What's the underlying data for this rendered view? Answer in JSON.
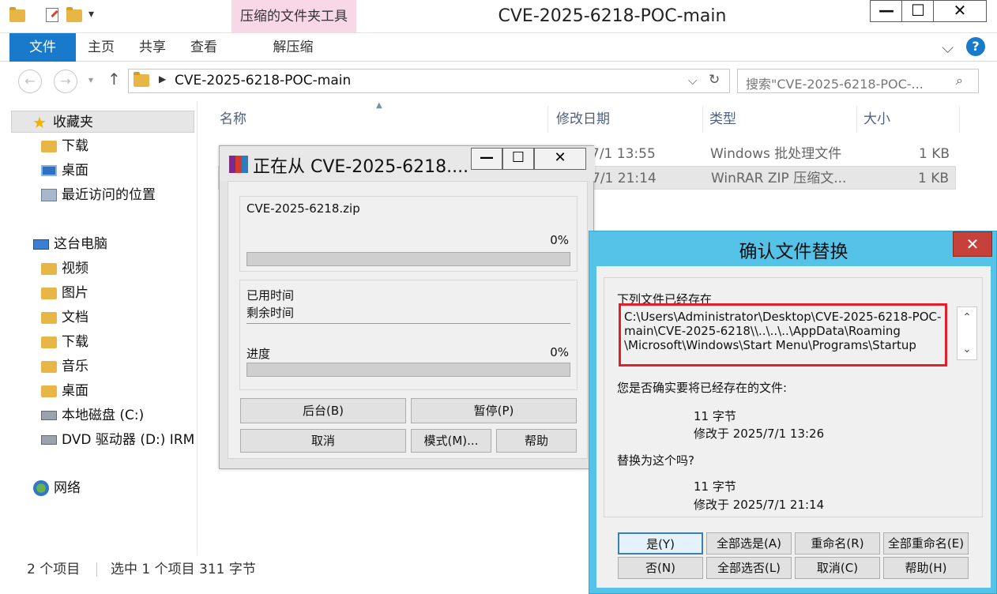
{
  "explorer": {
    "window_title": "CVE-2025-6218-POC-main",
    "context_tab_header": "压缩的文件夹工具",
    "caption_buttons": {
      "minimize": "—",
      "maximize": "☐",
      "close": "✕"
    },
    "ribbon_tabs": [
      "文件",
      "主页",
      "共享",
      "查看",
      "解压缩"
    ],
    "help": "?",
    "address": "CVE-2025-6218-POC-main",
    "search_placeholder": "搜索\"CVE-2025-6218-POC-...",
    "nav": {
      "favorites": "收藏夹",
      "downloads": "下载",
      "desktop": "桌面",
      "recent": "最近访问的位置",
      "this_pc": "这台电脑",
      "videos": "视频",
      "pictures": "图片",
      "documents": "文档",
      "downloads2": "下载",
      "music": "音乐",
      "desktop2": "桌面",
      "local_disk": "本地磁盘 (C:)",
      "dvd": "DVD 驱动器 (D:) IRM",
      "network": "网络"
    },
    "columns": {
      "name": "名称",
      "modified": "修改日期",
      "type": "类型",
      "size": "大小"
    },
    "files": [
      {
        "modified": "7/1 13:55",
        "type": "Windows 批处理文件",
        "size": "1 KB"
      },
      {
        "modified": "7/1 21:14",
        "type": "WinRAR ZIP 压缩文...",
        "size": "1 KB"
      }
    ],
    "status": {
      "items": "2 个项目",
      "selected": "选中 1 个项目  311 字节"
    }
  },
  "rar_dialog": {
    "title": "正在从 CVE-2025-6218....",
    "archive_name": "CVE-2025-6218.zip",
    "file_percent": "0%",
    "file_progress": 0,
    "elapsed_label": "已用时间",
    "remaining_label": "剩余时间",
    "progress_label": "进度",
    "total_percent": "0%",
    "total_progress": 0,
    "buttons": {
      "background": "后台(B)",
      "pause": "暂停(P)",
      "cancel": "取消",
      "mode": "模式(M)...",
      "help": "帮助"
    }
  },
  "confirm_dialog": {
    "title": "确认文件替换",
    "close": "✕",
    "exists_label": "下列文件已经存在",
    "path_line1": "C:\\Users\\Administrator\\Desktop\\CVE-2025-6218-POC-",
    "path_line2": "main\\CVE-2025-6218\\\\..\\..\\..\\AppData\\Roaming",
    "path_line3": "\\Microsoft\\Windows\\Start Menu\\Programs\\Startup",
    "question": "您是否确实要将已经存在的文件:",
    "existing_size": "11 字节",
    "existing_modified": "修改于 2025/7/1 13:26",
    "replace_question": "替换为这个吗?",
    "new_size": "11 字节",
    "new_modified": "修改于 2025/7/1 21:14",
    "buttons": {
      "yes": "是(Y)",
      "yes_all": "全部选是(A)",
      "rename": "重命名(R)",
      "rename_all": "全部重命名(E)",
      "no": "否(N)",
      "no_all": "全部选否(L)",
      "cancel": "取消(C)",
      "help": "帮助(H)"
    }
  }
}
